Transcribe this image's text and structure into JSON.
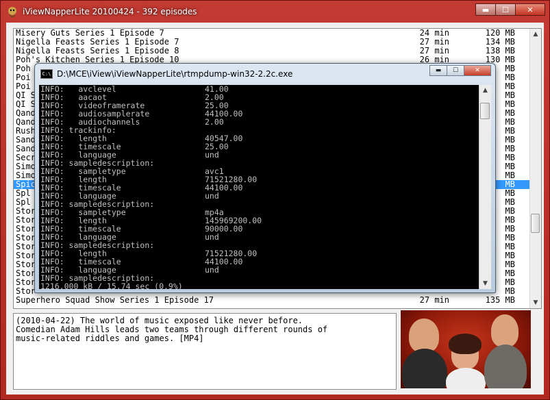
{
  "window": {
    "title": "iViewNapperLite 20100424 - 392 episodes",
    "minimize": "▬",
    "maximize": "☐",
    "close": "✕"
  },
  "episodes": [
    {
      "title": "Misery Guts Series 1 Episode 7",
      "duration": "24 min",
      "size": "120 MB"
    },
    {
      "title": "Nigella Feasts Series 1 Episode 7",
      "duration": "27 min",
      "size": "134 MB"
    },
    {
      "title": "Nigella Feasts Series 1 Episode 8",
      "duration": "27 min",
      "size": "138 MB"
    },
    {
      "title": "Poh's Kitchen Series 1 Episode 10",
      "duration": "26 min",
      "size": "130 MB"
    },
    {
      "title": "Poh",
      "duration": "",
      "size": "MB"
    },
    {
      "title": "Poi",
      "duration": "",
      "size": "MB"
    },
    {
      "title": "Poi",
      "duration": "",
      "size": "MB"
    },
    {
      "title": "QI S",
      "duration": "",
      "size": "MB"
    },
    {
      "title": "QI S",
      "duration": "",
      "size": "MB"
    },
    {
      "title": "Qand",
      "duration": "",
      "size": "MB"
    },
    {
      "title": "Qand",
      "duration": "",
      "size": "MB"
    },
    {
      "title": "Rush",
      "duration": "",
      "size": "MB"
    },
    {
      "title": "Sand",
      "duration": "",
      "size": "MB"
    },
    {
      "title": "Sand",
      "duration": "",
      "size": "MB"
    },
    {
      "title": "Secr",
      "duration": "",
      "size": "MB"
    },
    {
      "title": "Simo",
      "duration": "",
      "size": "MB"
    },
    {
      "title": "Simo",
      "duration": "",
      "size": "MB"
    },
    {
      "title": "Spic",
      "duration": "",
      "size": "MB",
      "selected": true
    },
    {
      "title": "Spl",
      "duration": "",
      "size": "MB"
    },
    {
      "title": "Spl",
      "duration": "",
      "size": "MB"
    },
    {
      "title": "Stor",
      "duration": "",
      "size": "MB"
    },
    {
      "title": "Stor",
      "duration": "",
      "size": "MB"
    },
    {
      "title": "Stor",
      "duration": "",
      "size": "MB"
    },
    {
      "title": "Stor",
      "duration": "",
      "size": "MB"
    },
    {
      "title": "Stor",
      "duration": "",
      "size": "MB"
    },
    {
      "title": "Stor",
      "duration": "",
      "size": "MB"
    },
    {
      "title": "Stor",
      "duration": "",
      "size": "MB"
    },
    {
      "title": "Stor",
      "duration": "",
      "size": "MB"
    },
    {
      "title": "Stor",
      "duration": "",
      "size": "MB"
    },
    {
      "title": "Stor",
      "duration": "",
      "size": "MB"
    },
    {
      "title": "Superhero Squad Show Series 1 Episode 17",
      "duration": "27 min",
      "size": "135 MB"
    }
  ],
  "description": "(2010-04-22) The world of music exposed like never before.\nComedian Adam Hills leads two teams through different rounds of\nmusic-related riddles and games. [MP4]",
  "console": {
    "title": "D:\\MCE\\iView\\iViewNapperLite\\rtmpdump-win32-2.2c.exe",
    "icon_text": "C:\\",
    "minimize": "▬",
    "maximize": "☐",
    "close": "✕",
    "lines": [
      {
        "label": "INFO:   avclevel",
        "value": "41.00"
      },
      {
        "label": "INFO:   aacaot",
        "value": "2.00"
      },
      {
        "label": "INFO:   videoframerate",
        "value": "25.00"
      },
      {
        "label": "INFO:   audiosamplerate",
        "value": "44100.00"
      },
      {
        "label": "INFO:   audiochannels",
        "value": "2.00"
      },
      {
        "label": "INFO: trackinfo:",
        "value": ""
      },
      {
        "label": "INFO:   length",
        "value": "40547.00"
      },
      {
        "label": "INFO:   timescale",
        "value": "25.00"
      },
      {
        "label": "INFO:   language",
        "value": "und"
      },
      {
        "label": "INFO: sampledescription:",
        "value": ""
      },
      {
        "label": "INFO:   sampletype",
        "value": "avc1"
      },
      {
        "label": "INFO:   length",
        "value": "71521280.00"
      },
      {
        "label": "INFO:   timescale",
        "value": "44100.00"
      },
      {
        "label": "INFO:   language",
        "value": "und"
      },
      {
        "label": "INFO: sampledescription:",
        "value": ""
      },
      {
        "label": "INFO:   sampletype",
        "value": "mp4a"
      },
      {
        "label": "INFO:   length",
        "value": "145969200.00"
      },
      {
        "label": "INFO:   timescale",
        "value": "90000.00"
      },
      {
        "label": "INFO:   language",
        "value": "und"
      },
      {
        "label": "INFO: sampledescription:",
        "value": ""
      },
      {
        "label": "INFO:   length",
        "value": "71521280.00"
      },
      {
        "label": "INFO:   timescale",
        "value": "44100.00"
      },
      {
        "label": "INFO:   language",
        "value": "und"
      },
      {
        "label": "INFO: sampledescription:",
        "value": ""
      },
      {
        "label": "1216.000 kB / 15.74 sec (0.9%)",
        "value": ""
      }
    ]
  },
  "icons": {
    "scroll_up": "▲",
    "scroll_down": "▼"
  }
}
